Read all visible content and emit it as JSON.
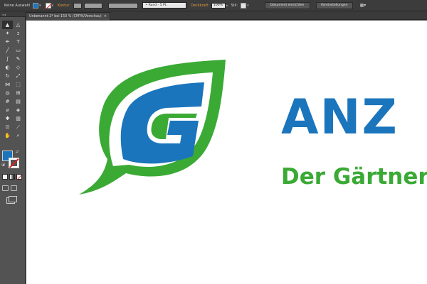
{
  "control_bar": {
    "selection_label": "Keine Auswahl",
    "stroke_link": "Kontur:",
    "brush_prefix": "•",
    "brush_value": "Rund - 5 Pt.",
    "opacity_link": "Deckkraft:",
    "opacity_value": "100%",
    "style_label": "Stil:",
    "document_setup_button": "Dokument einrichten",
    "preferences_button": "Voreinstellungen",
    "colors": {
      "fill": "#1b75bc",
      "stroke_none_slash": "#e01f1f"
    }
  },
  "document_tab": {
    "title": "Unbenannt-2* bei 150 % (CMYK/Vorschau)",
    "close_glyph": "×"
  },
  "toolbox": {
    "grip": "◂◂",
    "tools": [
      {
        "name": "selection-tool",
        "glyph": "▲"
      },
      {
        "name": "direct-selection-tool",
        "glyph": "△"
      },
      {
        "name": "magic-wand-tool",
        "glyph": "✦"
      },
      {
        "name": "lasso-tool",
        "glyph": "ↄ"
      },
      {
        "name": "pen-tool",
        "glyph": "✒"
      },
      {
        "name": "type-tool",
        "glyph": "T"
      },
      {
        "name": "line-segment-tool",
        "glyph": "╱"
      },
      {
        "name": "rectangle-tool",
        "glyph": "▭"
      },
      {
        "name": "paintbrush-tool",
        "glyph": "∫"
      },
      {
        "name": "pencil-tool",
        "glyph": "✎"
      },
      {
        "name": "blob-brush-tool",
        "glyph": "◐"
      },
      {
        "name": "eraser-tool",
        "glyph": "◇"
      },
      {
        "name": "rotate-tool",
        "glyph": "↻"
      },
      {
        "name": "scale-tool",
        "glyph": "⤢"
      },
      {
        "name": "width-tool",
        "glyph": "⋈"
      },
      {
        "name": "free-transform-tool",
        "glyph": "⬚"
      },
      {
        "name": "shape-builder-tool",
        "glyph": "◎"
      },
      {
        "name": "perspective-grid-tool",
        "glyph": "⊞"
      },
      {
        "name": "mesh-tool",
        "glyph": "#"
      },
      {
        "name": "gradient-tool",
        "glyph": "▤"
      },
      {
        "name": "eyedropper-tool",
        "glyph": "⌀"
      },
      {
        "name": "blend-tool",
        "glyph": "◈"
      },
      {
        "name": "symbol-sprayer-tool",
        "glyph": "✱"
      },
      {
        "name": "column-graph-tool",
        "glyph": "▥"
      },
      {
        "name": "artboard-tool",
        "glyph": "⊡"
      },
      {
        "name": "slice-tool",
        "glyph": "⟋"
      },
      {
        "name": "hand-tool",
        "glyph": "✋"
      },
      {
        "name": "zoom-tool",
        "glyph": "⌕"
      }
    ],
    "swap_glyph": "⇄",
    "default_glyph": "◪"
  },
  "artwork": {
    "logo_text": "ANZ",
    "tagline": "Der Gärtner",
    "colors": {
      "blue": "#1b75bc",
      "green": "#3aaa35"
    }
  }
}
